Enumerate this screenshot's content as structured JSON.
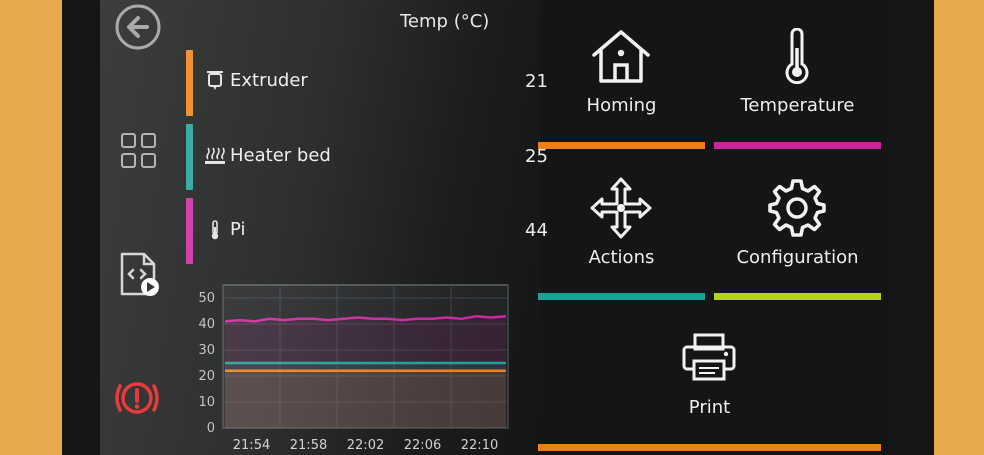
{
  "temperature_panel": {
    "header": "Temp (°C)",
    "heaters": [
      {
        "name": "Extruder",
        "value": "21",
        "color": "#f07f15",
        "icon": "extruder-icon"
      },
      {
        "name": "Heater bed",
        "value": "25",
        "color": "#1aa195",
        "icon": "heater-bed-icon"
      },
      {
        "name": "Pi",
        "value": "44",
        "color": "#c9259d",
        "icon": "thermometer-icon"
      }
    ]
  },
  "sidebar": {
    "items": [
      {
        "icon": "back-arrow-icon"
      },
      {
        "icon": "grid-menu-icon"
      },
      {
        "icon": "gcode-file-icon"
      },
      {
        "icon": "emergency-stop-icon",
        "color": "#e31b1b"
      }
    ]
  },
  "menu": {
    "tiles": [
      {
        "label": "Homing",
        "icon": "home-icon",
        "color": "#f07f15"
      },
      {
        "label": "Temperature",
        "icon": "thermometer-icon",
        "color": "#c9259d"
      },
      {
        "label": "Actions",
        "icon": "move-arrows-icon",
        "color": "#1aa195"
      },
      {
        "label": "Configuration",
        "icon": "gear-icon",
        "color": "#b4d41a"
      },
      {
        "label": "Print",
        "icon": "printer-icon",
        "color": "#f07f15"
      }
    ]
  },
  "chart_data": {
    "type": "line",
    "xlabel": "",
    "ylabel": "",
    "x_ticks": [
      "21:54",
      "21:58",
      "22:02",
      "22:06",
      "22:10"
    ],
    "y_ticks": [
      "50",
      "40",
      "30",
      "20",
      "10",
      "0"
    ],
    "ylim": [
      0,
      55
    ],
    "grid": true,
    "series": [
      {
        "name": "Pi",
        "color": "#c9259d",
        "values": [
          41,
          41.5,
          41,
          42,
          41.5,
          42,
          42,
          41.5,
          42,
          42.5,
          42,
          42,
          41.5,
          42,
          42,
          42.5,
          42,
          43,
          42.5,
          43
        ]
      },
      {
        "name": "Heater bed",
        "color": "#1aa195",
        "values": [
          25,
          25,
          25,
          25,
          25,
          25,
          25,
          25,
          25,
          25,
          25,
          25,
          25,
          25,
          25,
          25,
          25,
          25,
          25,
          25
        ]
      },
      {
        "name": "Extruder",
        "color": "#f07f15",
        "values": [
          22,
          22,
          22,
          22,
          22,
          22,
          22,
          22,
          22,
          22,
          22,
          22,
          22,
          22,
          22,
          22,
          22,
          22,
          22,
          22
        ]
      }
    ]
  }
}
